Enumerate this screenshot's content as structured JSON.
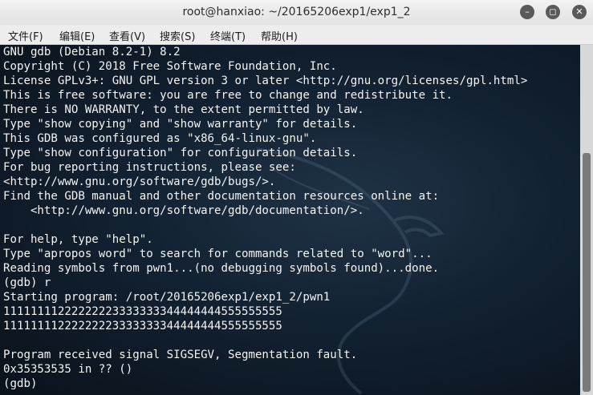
{
  "window": {
    "title": "root@hanxiao: ~/20165206exp1/exp1_2",
    "controls": {
      "minimize": "–",
      "maximize": "◻",
      "close": "✕"
    }
  },
  "menu": [
    "文件(F)",
    "编辑(E)",
    "查看(V)",
    "搜索(S)",
    "终端(T)",
    "帮助(H)"
  ],
  "terminal": {
    "lines": [
      "GNU gdb (Debian 8.2-1) 8.2",
      "Copyright (C) 2018 Free Software Foundation, Inc.",
      "License GPLv3+: GNU GPL version 3 or later <http://gnu.org/licenses/gpl.html>",
      "This is free software: you are free to change and redistribute it.",
      "There is NO WARRANTY, to the extent permitted by law.",
      "Type \"show copying\" and \"show warranty\" for details.",
      "This GDB was configured as \"x86_64-linux-gnu\".",
      "Type \"show configuration\" for configuration details.",
      "For bug reporting instructions, please see:",
      "<http://www.gnu.org/software/gdb/bugs/>.",
      "Find the GDB manual and other documentation resources online at:",
      "    <http://www.gnu.org/software/gdb/documentation/>.",
      "",
      "For help, type \"help\".",
      "Type \"apropos word\" to search for commands related to \"word\"...",
      "Reading symbols from pwn1...(no debugging symbols found)...done.",
      "(gdb) r",
      "Starting program: /root/20165206exp1/exp1_2/pwn1",
      "11111111222222223333333344444444555555555",
      "11111111222222223333333344444444555555555",
      "",
      "Program received signal SIGSEGV, Segmentation fault.",
      "0x35353535 in ?? ()",
      "(gdb) "
    ]
  }
}
